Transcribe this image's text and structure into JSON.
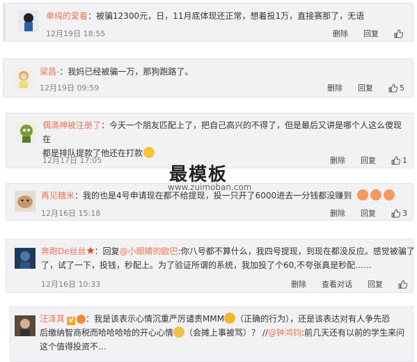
{
  "comments": [
    {
      "name": "单纯的爱着",
      "text": "：被骗12300元，日，11月底体现还正常，想着投1万，直接赛那了，无语",
      "time": "12月19日 18:55",
      "actions": [
        "删除",
        "回复"
      ],
      "likes": ""
    },
    {
      "name": "梁昌-",
      "text": "：我妈已经被骗一万，那狗跑路了。",
      "time": "12月19日 09:59",
      "actions": [
        "删除",
        "回复"
      ],
      "likes": "5"
    },
    {
      "name": "偶滴神被注册了",
      "text1": "：今天一个朋友匹配上了，把自己高兴的不得了，但是最后又讲是哪个人这么傻现在",
      "text2": "都是排队提款了他还在打款",
      "time": "12月17日 17:05",
      "actions": [
        "删除",
        "回复"
      ],
      "likes": "1"
    },
    {
      "name": "再见糖米",
      "text": "：我的也是4号申请现在都不给提现，投一只开了6000进去一分钱都没赚到",
      "time": "12月16日 15:18",
      "actions": [
        "删除",
        "回复"
      ],
      "likes": "3"
    },
    {
      "name": "奔跑De丝丝",
      "text_a": "：回复",
      "mention": "@小眼睛的欧巴",
      "text_b": ":你八号都不算什么，我四号提现，到现在都没反应。感觉被骗了",
      "text2": "了，试了一下，投钱，秒配上。为了验证所谓的系统，我加投了个60,不夸张真是秒配……",
      "time": "12月16日 10:33",
      "actions": [
        "删除",
        "查看对话",
        "回复"
      ],
      "likes": ""
    },
    {
      "name": "汪泽其",
      "text_a": "：我是该表示心情沉重严厉谴责MMM",
      "text_b": "（正确的行为），还是该表达对有人争先恐",
      "text2_a": "后缴纳智商税而哈哈哈哈的开心心情",
      "text2_b": "（会摊上事被骂）？ //",
      "mention": "@钟鸿钧",
      "text2_c": ":前几天还有以前的学生来问",
      "text3": "这个值得投资不…"
    }
  ],
  "watermark": {
    "line1": "最模板",
    "line2": "www.zuimoban.com"
  },
  "icons": {
    "like": "thumbs-up-icon",
    "vip": "v-badge-icon",
    "star": "star-icon"
  }
}
